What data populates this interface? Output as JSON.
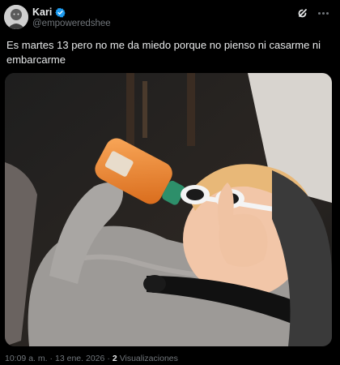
{
  "tweet": {
    "author": {
      "display_name": "Kari",
      "handle": "@empoweredshee",
      "verified_icon": "verified-badge-icon"
    },
    "text": "Es martes 13 pero no me da miedo porque no pienso ni casarme ni\nembarcarme",
    "media": {
      "kind": "photo",
      "icon": "photo"
    },
    "meta": {
      "time": "10:09 a. m.",
      "separator": "·",
      "date": "13 ene. 2026",
      "separator2": "·",
      "views_count": "2",
      "views_label": "Visualizaciones"
    },
    "actions": {
      "grok_icon": "grok-icon",
      "more_icon": "more-options-icon"
    }
  },
  "colors": {
    "background": "#000000",
    "text_primary": "#e7e9ea",
    "text_secondary": "#71767b",
    "verified_blue": "#1d9bf0"
  }
}
